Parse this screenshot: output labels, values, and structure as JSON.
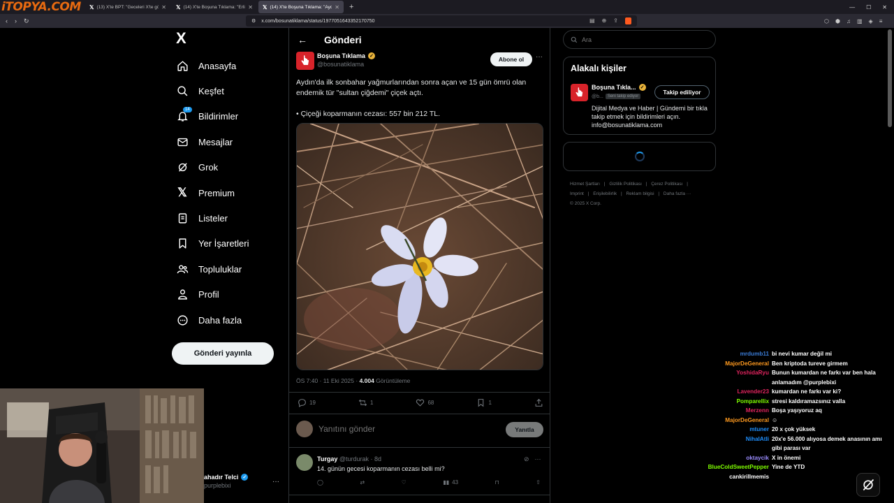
{
  "browser": {
    "brand_logo": "iTOPYA.COM",
    "tabs": [
      {
        "title": "(13) X'te BPT: \"Geceleri X'te gönderi paylaşan...",
        "active": false
      },
      {
        "title": "(14) X'te Boşuna Tıklama: \"Erling Haaland...",
        "active": false
      },
      {
        "title": "(14) X'te Boşuna Tıklama: \"Aydın'da ilk sonbahar...",
        "active": true
      }
    ],
    "url": "x.com/bosunatiklama/status/1977051643352170750"
  },
  "nav": {
    "logo": "X",
    "items": [
      {
        "label": "Anasayfa",
        "icon": "home-icon"
      },
      {
        "label": "Keşfet",
        "icon": "search-icon"
      },
      {
        "label": "Bildirimler",
        "icon": "bell-icon",
        "badge": "14"
      },
      {
        "label": "Mesajlar",
        "icon": "mail-icon"
      },
      {
        "label": "Grok",
        "icon": "grok-icon"
      },
      {
        "label": "Premium",
        "icon": "x-icon"
      },
      {
        "label": "Listeler",
        "icon": "list-icon"
      },
      {
        "label": "Yer İşaretleri",
        "icon": "bookmark-icon"
      },
      {
        "label": "Topluluklar",
        "icon": "people-icon"
      },
      {
        "label": "Profil",
        "icon": "profile-icon"
      },
      {
        "label": "Daha fazla",
        "icon": "more-circle-icon"
      }
    ],
    "post_button": "Gönderi yayınla"
  },
  "main": {
    "title": "Gönderi",
    "post": {
      "author_name": "Boşuna Tıklama",
      "author_handle": "@bosunatiklama",
      "follow_label": "Abone ol",
      "text_line1": "Aydın'da ilk sonbahar yağmurlarından sonra açan ve 15 gün ömrü olan endemik tür \"sultan çiğdemi\" çiçek açtı.",
      "text_line2": "• Çiçeği koparmanın cezası: 557 bin 212 TL.",
      "timestamp": "ÖS 7:40 · 11 Eki 2025 ·",
      "views": "4.004",
      "views_label": "Görüntüleme",
      "replies": "19",
      "reposts": "1",
      "likes": "68",
      "bookmarks": "1"
    },
    "reply_placeholder": "Yanıtını gönder",
    "reply_button": "Yanıtla",
    "comment": {
      "name": "Turgay",
      "handle": "@turdurak",
      "age": "· 8d",
      "text": "14. günün gecesi koparmanın cezası belli mi?",
      "views": "43"
    }
  },
  "right": {
    "search_placeholder": "Ara",
    "related_title": "Alakalı kişiler",
    "related_name": "Boşuna Tıkla...",
    "related_handle": "@b...",
    "follows_you": "Seni takip ediyor",
    "following_label": "Takip ediliyor",
    "related_bio": "Dijital Medya ve Haber | Gündemi bir tıkla takip etmek için bildirimleri açın. info@bosunatiklama.com",
    "footer": [
      "Hizmet Şartları",
      "|",
      "Gizlilik Politikası",
      "|",
      "Çerez Politikası",
      "|",
      "Imprint",
      "|",
      "Erişilebilirlik",
      "|",
      "Reklam bilgisi",
      "|",
      "Daha fazla ···",
      "© 2025 X Corp."
    ]
  },
  "stream": {
    "streamer_name": "ahadır Telci",
    "streamer_handle": "purplebixi",
    "chat": [
      {
        "user": "mrdumb11",
        "color": "#3a7bd5",
        "text": "bi nevi kumar değil mi"
      },
      {
        "user": "MajorDeGeneral",
        "color": "#ff9a1f",
        "text": "Ben kriptoda tureve girmem"
      },
      {
        "user": "YoshidaRyu",
        "color": "#e0245e",
        "text": "Bunun kumardan ne farkı var ben hala anlamadım @purplebixi"
      },
      {
        "user": "Lavender23",
        "color": "#e0245e",
        "text": "kumardan ne farkı var ki?"
      },
      {
        "user": "Pomparellix",
        "color": "#7fff00",
        "text": "stresi kaldıramazsınız valla"
      },
      {
        "user": "Merzenn",
        "color": "#e0245e",
        "text": "Boşa yaşıyoruz aq"
      },
      {
        "user": "MajorDeGeneral",
        "color": "#ff9a1f",
        "text": "☺"
      },
      {
        "user": "mtuner",
        "color": "#1e90ff",
        "text": "20 x çok yüksek"
      },
      {
        "user": "NihalAtli",
        "color": "#1e90ff",
        "text": "20x'e 56.000 alıyosa demek anasının amı gibi parası var"
      },
      {
        "user": "oktaycik",
        "color": "#9b8cff",
        "text": "X in önemi"
      },
      {
        "user": "BlueColdSweetPepper",
        "color": "#7fff00",
        "text": "Yine de YTD"
      },
      {
        "user": "cankirillmemis",
        "color": "#ffffff",
        "text": ""
      }
    ]
  }
}
